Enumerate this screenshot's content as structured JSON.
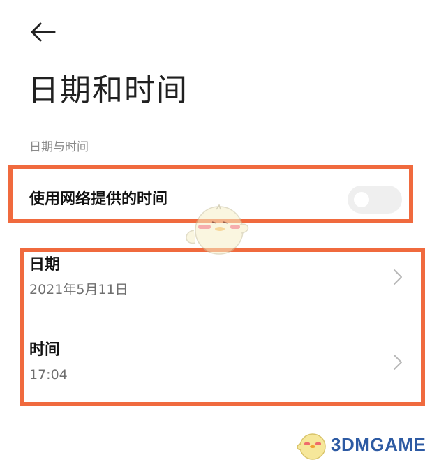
{
  "header": {
    "back_icon": "arrow-left-icon",
    "title": "日期和时间"
  },
  "section": {
    "title": "日期与时间"
  },
  "settings": {
    "network_time": {
      "label": "使用网络提供的时间",
      "toggle_on": false
    },
    "date": {
      "label": "日期",
      "value": "2021年5月11日",
      "icon": "chevron-right-icon"
    },
    "time": {
      "label": "时间",
      "value": "17:04",
      "icon": "chevron-right-icon"
    }
  },
  "annotations": {
    "highlight_color": "#f06a3e"
  },
  "watermark": {
    "text": "3DMGAME",
    "color": "#2d5aa3"
  }
}
